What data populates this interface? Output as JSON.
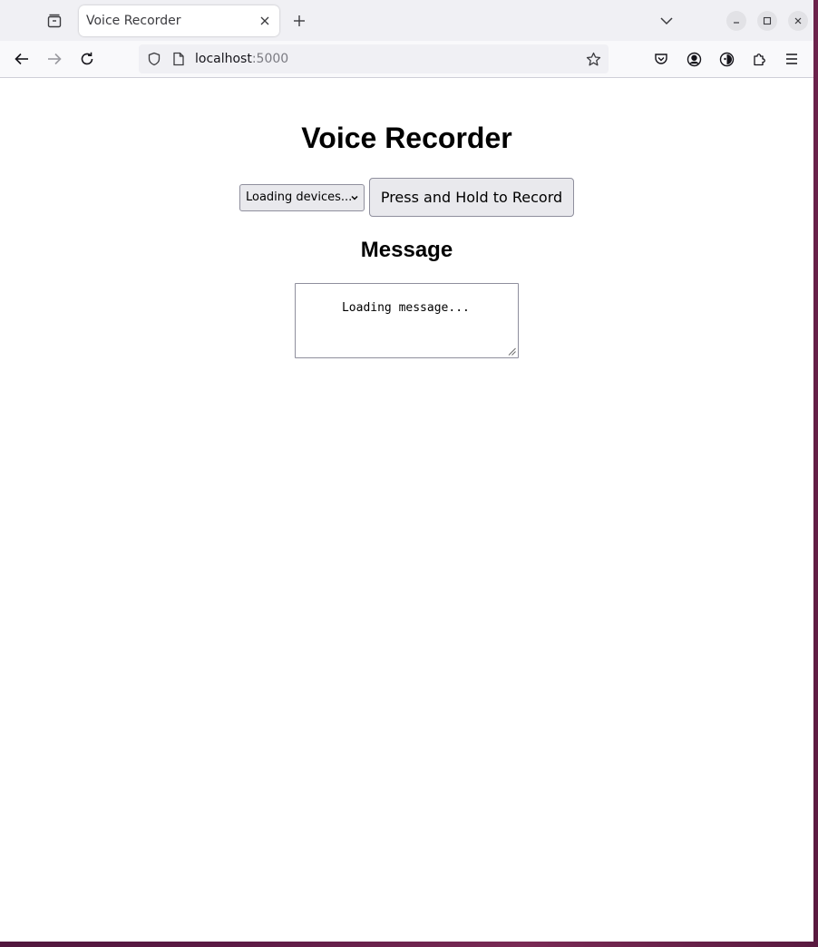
{
  "browser": {
    "tab": {
      "title": "Voice Recorder"
    },
    "url": {
      "host": "localhost",
      "port": ":5000"
    }
  },
  "page": {
    "title": "Voice Recorder",
    "device_select": {
      "selected": "Loading devices..."
    },
    "record_button_label": "Press and Hold to Record",
    "message_heading": "Message",
    "message_text": "Loading message..."
  }
}
